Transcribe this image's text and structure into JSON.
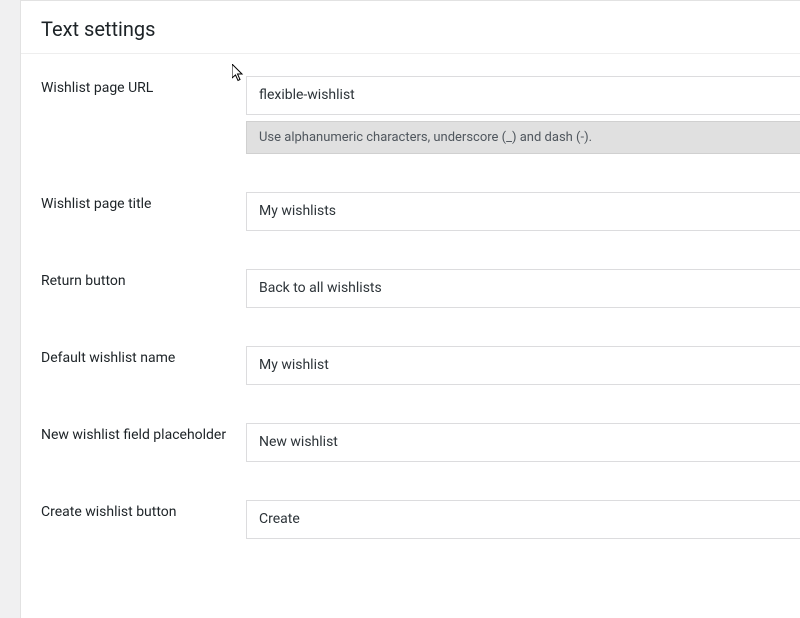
{
  "section_title": "Text settings",
  "fields": {
    "wishlist_page_url": {
      "label": "Wishlist page URL",
      "value": "flexible-wishlist",
      "help": "Use alphanumeric characters, underscore (_) and dash (-)."
    },
    "wishlist_page_title": {
      "label": "Wishlist page title",
      "value": "My wishlists"
    },
    "return_button": {
      "label": "Return button",
      "value": "Back to all wishlists"
    },
    "default_wishlist_name": {
      "label": "Default wishlist name",
      "value": "My wishlist"
    },
    "new_wishlist_placeholder": {
      "label": "New wishlist field placeholder",
      "value": "New wishlist"
    },
    "create_wishlist_button": {
      "label": "Create wishlist button",
      "value": "Create"
    }
  }
}
